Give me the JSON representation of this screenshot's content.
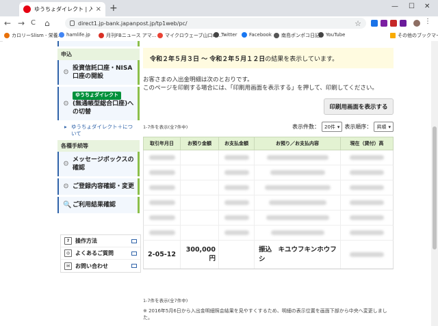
{
  "browser": {
    "tab_title": "ゆうちょダイレクト | 入出金明細照会",
    "tab_close": "×",
    "new_tab": "+",
    "window_controls": [
      "—",
      "☐",
      "✕"
    ],
    "url": "direct1.jp-bank.japanpost.jp/tp1web/pc/",
    "nav": [
      "←",
      "→",
      "C",
      "⌂"
    ],
    "bookmarks": [
      {
        "label": "カロリーSlism - 栄養...",
        "color": "#e8710a"
      },
      {
        "label": "hamlife.jp",
        "color": "#4285f4"
      },
      {
        "label": "月刊FBニュース アマ...",
        "color": "#d93025"
      },
      {
        "label": "マイクロウェーブ山口の...",
        "color": "#ea4335"
      },
      {
        "label": "Twitter",
        "color": "#444444"
      },
      {
        "label": "Facebook",
        "color": "#1877f2"
      },
      {
        "label": "南島ポンポコ日記",
        "color": "#555555"
      },
      {
        "label": "YouTube",
        "color": "#444444"
      }
    ],
    "other_bookmarks": "その他のブックマーク"
  },
  "sidebar": {
    "section_apply": "申込",
    "items_apply": [
      {
        "label": "投資信託口座・NISA口座の開設"
      },
      {
        "logo": "ゆうちょダイレクト",
        "label": "(無通帳型総合口座)への切替"
      }
    ],
    "link_plus": "ゆうちょダイレクト＋について",
    "section_procedures": "各種手続等",
    "items_procedures": [
      {
        "label": "メッセージボックスの確認"
      },
      {
        "label": "ご登録内容確認・変更"
      },
      {
        "label": "ご利用結果確認"
      }
    ],
    "help": [
      {
        "label": "操作方法",
        "icon": "?"
      },
      {
        "label": "よくあるご質問",
        "icon": "◎"
      },
      {
        "label": "お問い合わせ",
        "icon": "✉"
      }
    ]
  },
  "main": {
    "period_text": "令和２年５月３日 ～ 令和２年５月１２日",
    "period_tail": "の結果を表示しています。",
    "note1": "お客さまの入出金明細は次のとおりです。",
    "note2": "このページを印刷する場合には、「印刷用画面を表示する」を押して、印刷してください。",
    "print_button": "印刷用画面を表示する",
    "count_top": "1-7件を表示(全7件中)",
    "count_bottom": "1-7件を表示(全7件中)",
    "per_page_label": "表示件数：",
    "per_page_value": "20件",
    "sort_label": "表示順序：",
    "sort_value": "昇順",
    "columns": [
      "取引年月日",
      "お預り金額",
      "お支払金額",
      "お預り／お支払内容",
      "現在（貸付）高"
    ],
    "highlight_row": {
      "date": "2-05-12",
      "deposit": "300,000円",
      "payment": "",
      "description": "振込　キユウフキンホウフシ"
    },
    "notice": "※ 2016年5月6日から入出金明細照会結果を見やすくするため、明細の表示位置を画面下部から中央へ変更しました。"
  }
}
